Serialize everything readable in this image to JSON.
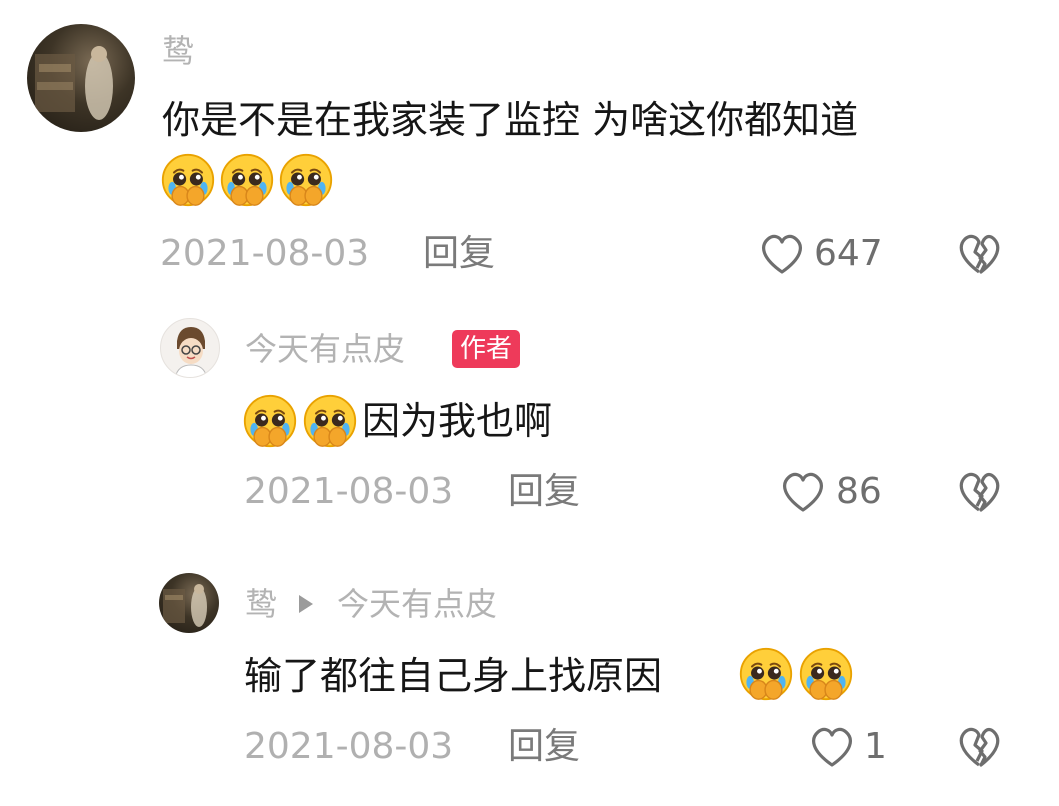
{
  "comments": [
    {
      "username": "鸷",
      "text": "你是不是在我家装了监控 为啥这你都知道",
      "date": "2021-08-03",
      "reply_label": "回复",
      "likes": "647"
    },
    {
      "username": "今天有点皮",
      "badge": "作者",
      "text": "因为我也啊",
      "date": "2021-08-03",
      "reply_label": "回复",
      "likes": "86"
    },
    {
      "username": "鸷",
      "reply_to": "今天有点皮",
      "text": "输了都往自己身上找原因",
      "date": "2021-08-03",
      "reply_label": "回复",
      "likes": "1"
    }
  ],
  "icons": {
    "emoji": "pleading-face-emoji",
    "like": "heart-icon",
    "dislike": "broken-heart-icon",
    "reply_arrow": "triangle-right-icon"
  },
  "colors": {
    "author_badge": "#ee3a5a",
    "username": "#b3b3b3",
    "text": "#161616"
  }
}
